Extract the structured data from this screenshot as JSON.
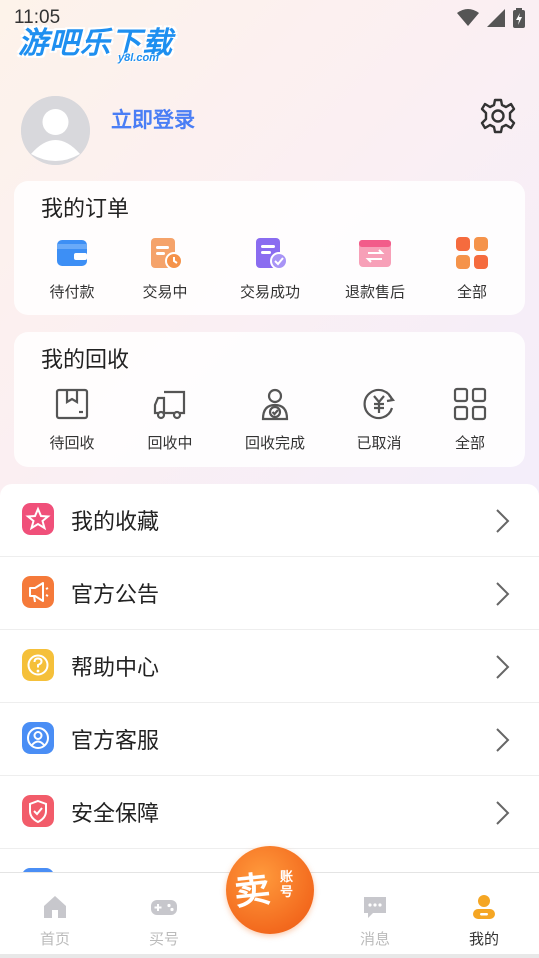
{
  "status_bar": {
    "time": "11:05"
  },
  "watermark": {
    "main": "游吧乐下载",
    "sub": "y8l.com"
  },
  "profile": {
    "login_label": "立即登录"
  },
  "orders": {
    "title": "我的订单",
    "items": [
      {
        "label": "待付款",
        "icon": "wallet-icon",
        "color": "#3d8ff5"
      },
      {
        "label": "交易中",
        "icon": "clipboard-clock-icon",
        "color": "#f5934a"
      },
      {
        "label": "交易成功",
        "icon": "document-check-icon",
        "color": "#8a6cf0"
      },
      {
        "label": "退款售后",
        "icon": "refund-card-icon",
        "color": "#f25c8a"
      },
      {
        "label": "全部",
        "icon": "grid-icon",
        "color": "#f56b3e"
      }
    ]
  },
  "recycle": {
    "title": "我的回收",
    "items": [
      {
        "label": "待回收",
        "icon": "box-icon"
      },
      {
        "label": "回收中",
        "icon": "truck-icon"
      },
      {
        "label": "回收完成",
        "icon": "person-check-icon"
      },
      {
        "label": "已取消",
        "icon": "yuan-refresh-icon"
      },
      {
        "label": "全部",
        "icon": "grid-outline-icon"
      }
    ]
  },
  "menu": [
    {
      "label": "我的收藏",
      "icon": "star-icon",
      "color": "#f0507a"
    },
    {
      "label": "官方公告",
      "icon": "megaphone-icon",
      "color": "#f57a3a"
    },
    {
      "label": "帮助中心",
      "icon": "help-icon",
      "color": "#f5c03a"
    },
    {
      "label": "官方客服",
      "icon": "support-icon",
      "color": "#4a8ef5"
    },
    {
      "label": "安全保障",
      "icon": "shield-icon",
      "color": "#f25c6a"
    }
  ],
  "tabbar": {
    "tabs": [
      {
        "label": "首页",
        "icon": "home-icon"
      },
      {
        "label": "买号",
        "icon": "gamepad-icon"
      },
      {
        "label": "消息",
        "icon": "message-icon"
      },
      {
        "label": "我的",
        "icon": "user-icon",
        "active": true
      }
    ],
    "sell": {
      "big": "卖",
      "small": "账号"
    }
  }
}
